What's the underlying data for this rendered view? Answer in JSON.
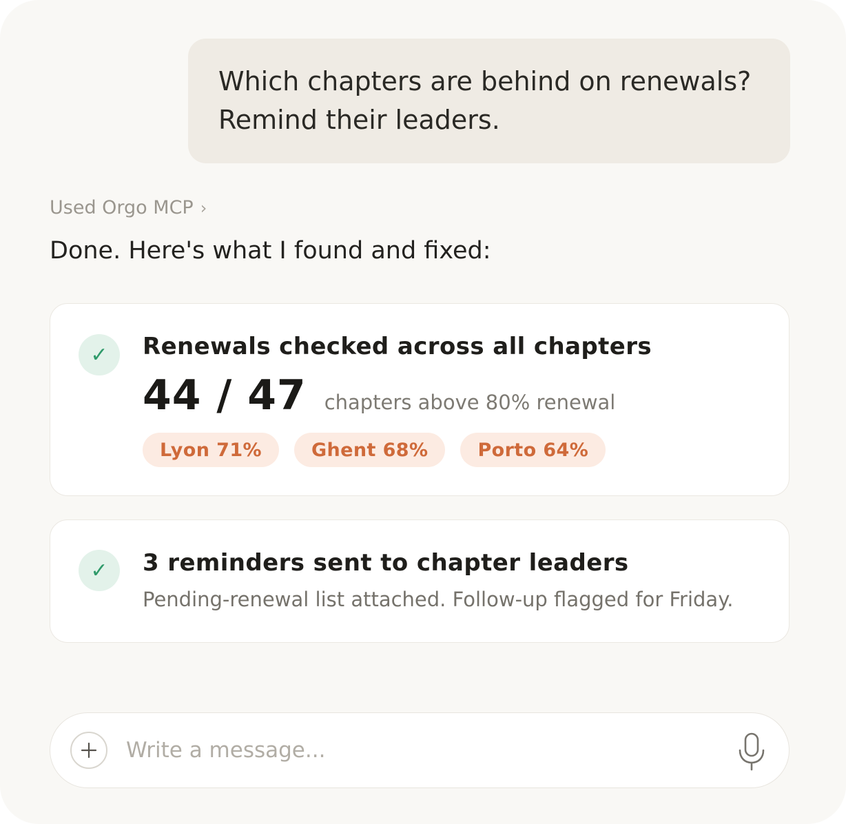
{
  "user_message": {
    "text": "Which chapters are behind on renewals? Remind their leaders."
  },
  "assistant": {
    "tool_use_label": "Used Orgo MCP",
    "tool_use_chevron": "›",
    "intro": "Done. Here's what I found and fixed:"
  },
  "cards": [
    {
      "status_icon": "checkmark-icon",
      "check_glyph": "✓",
      "title": "Renewals checked across all chapters",
      "stat_value": "44 / 47",
      "stat_caption": "chapters above 80% renewal",
      "chips": [
        {
          "label": "Lyon 71%"
        },
        {
          "label": "Ghent 68%"
        },
        {
          "label": "Porto 64%"
        }
      ]
    },
    {
      "status_icon": "checkmark-icon",
      "check_glyph": "✓",
      "title": "3 reminders sent to chapter leaders",
      "description": "Pending-renewal list attached. Follow-up flagged for Friday."
    }
  ],
  "composer": {
    "placeholder": "Write a message...",
    "value": "",
    "add_icon": "plus-icon",
    "mic_icon": "microphone-icon"
  },
  "colors": {
    "background": "#f9f8f5",
    "user_bubble": "#efebe4",
    "success": "#2f9a6a",
    "success_bg": "#e3f2ea",
    "chip_text": "#cf6a3a",
    "chip_bg": "#fcebe2"
  }
}
